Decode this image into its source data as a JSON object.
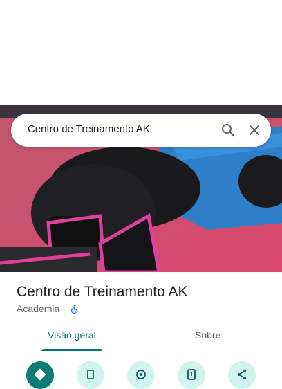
{
  "search": {
    "query": "Centro de Treinamento AK"
  },
  "place": {
    "name": "Centro de Treinamento AK",
    "category": "Academia",
    "separator": "·"
  },
  "tabs": [
    {
      "label": "Visão geral"
    },
    {
      "label": "Sobre"
    }
  ],
  "actions": [
    {
      "icon": "directions-icon"
    },
    {
      "icon": "phone-icon"
    },
    {
      "icon": "location-icon"
    },
    {
      "icon": "save-to-phone-icon"
    },
    {
      "icon": "share-icon"
    }
  ],
  "colors": {
    "accent": "#00796b",
    "action_bg": "#d2f4ee",
    "primary_action": "#0b7d74"
  }
}
